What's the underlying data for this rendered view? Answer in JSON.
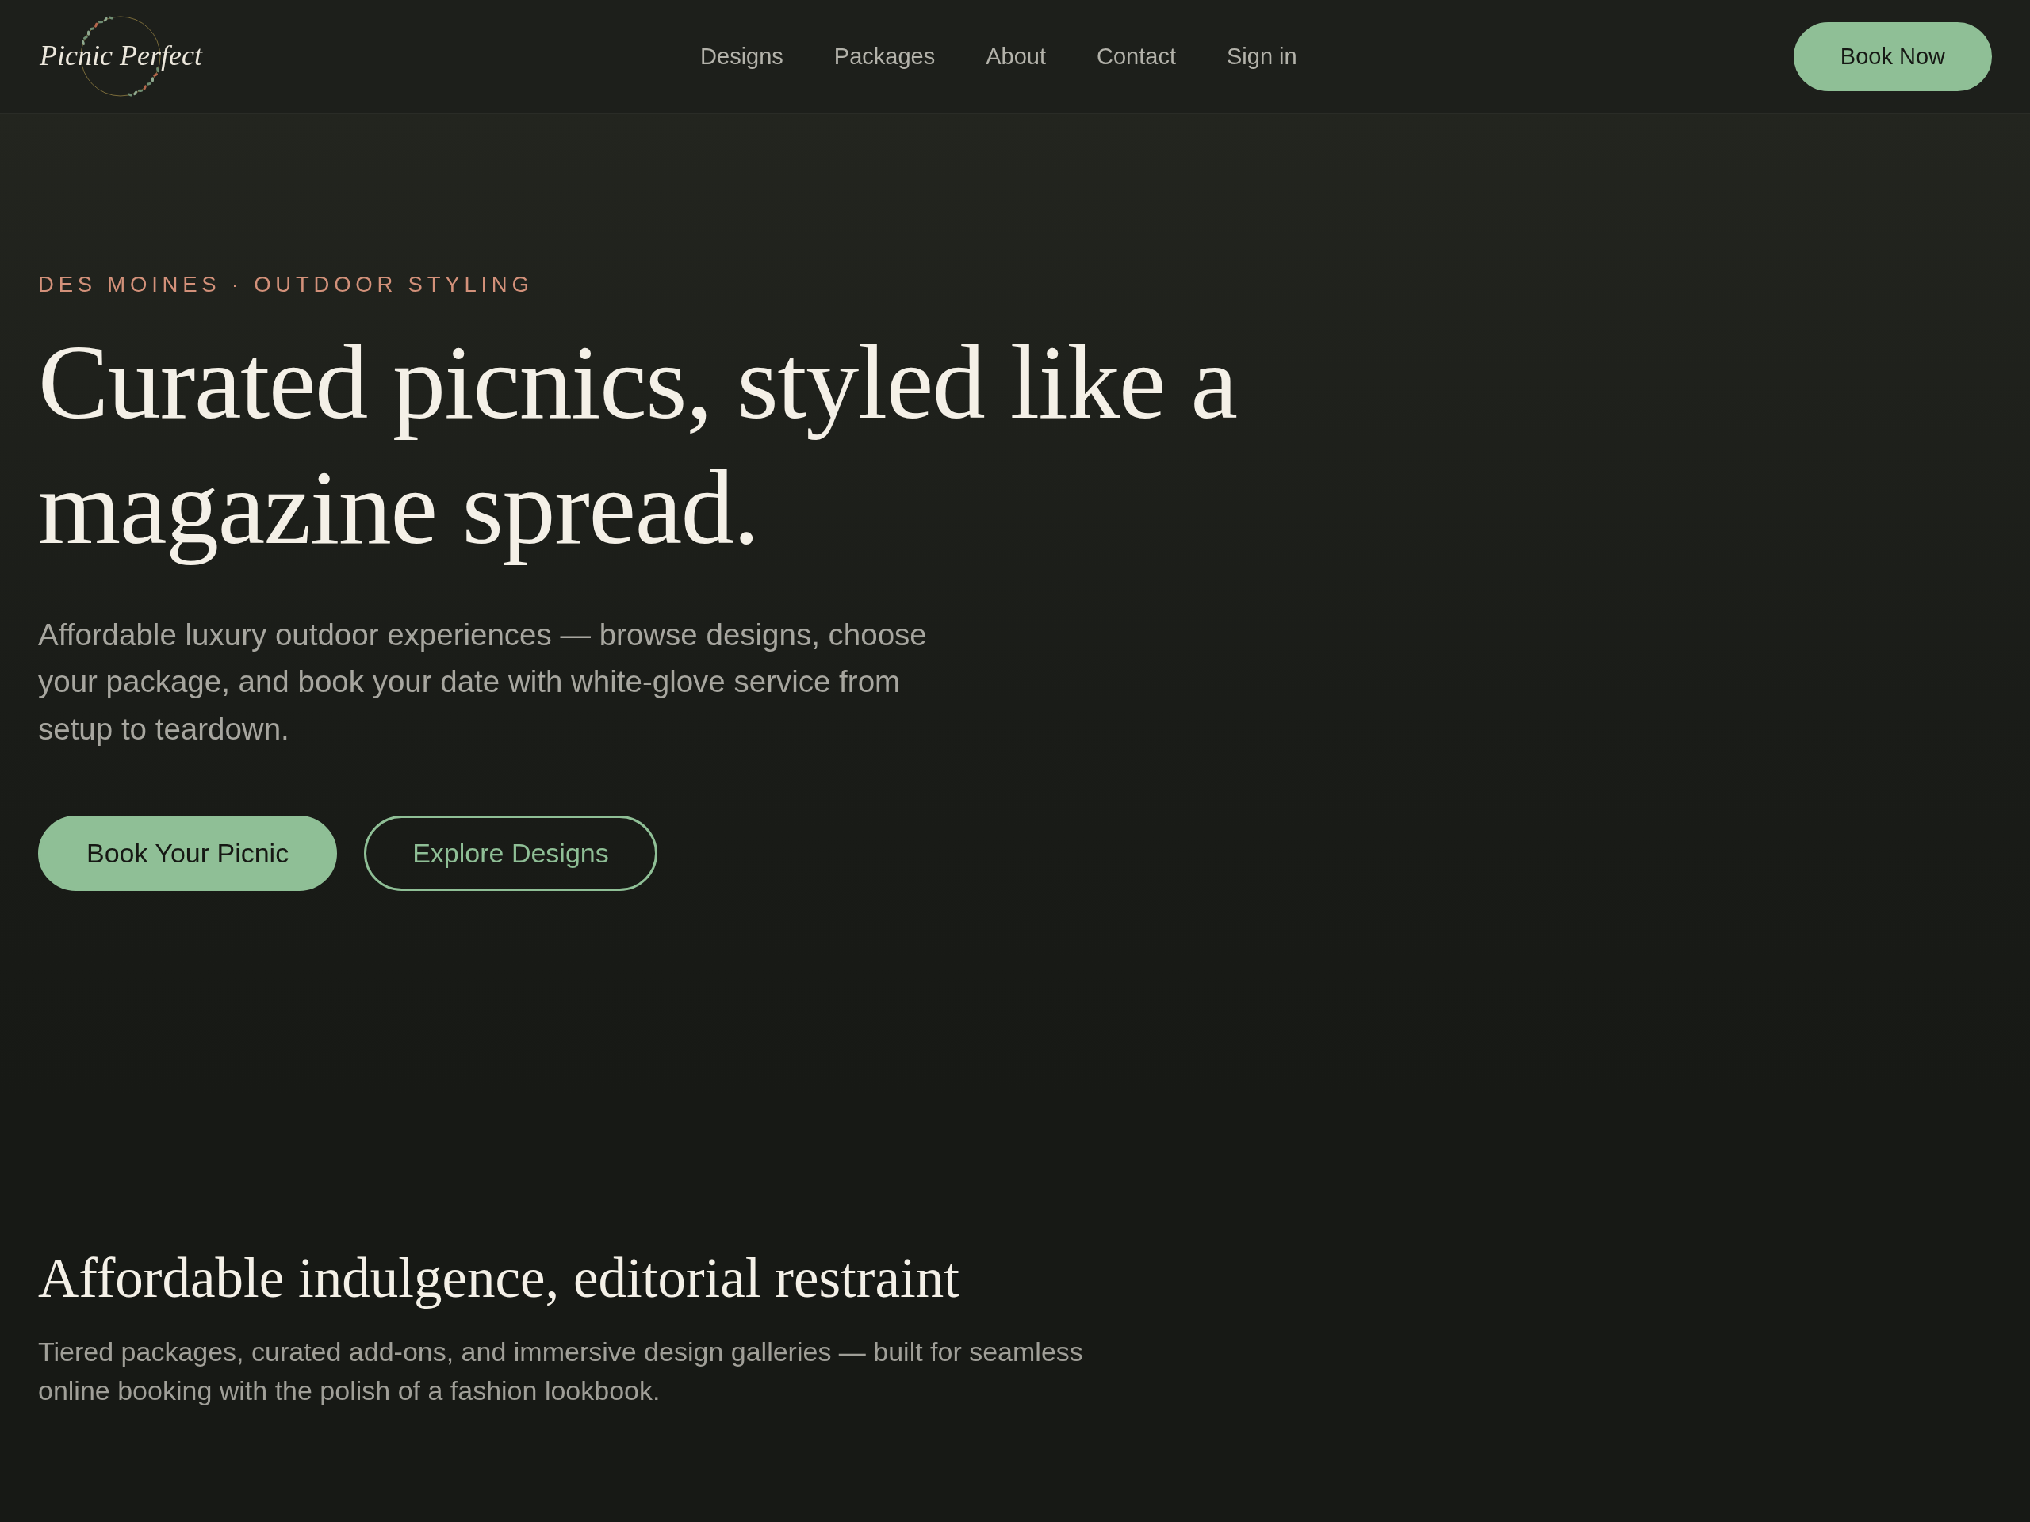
{
  "header": {
    "logo": "Picnic Perfect",
    "nav": [
      "Designs",
      "Packages",
      "About",
      "Contact",
      "Sign in"
    ],
    "cta": "Book Now"
  },
  "hero": {
    "eyebrow": "DES MOINES · OUTDOOR STYLING",
    "headline_lines": [
      "Curated picnics, styled like a",
      "magazine spread."
    ],
    "lede": "Affordable luxury outdoor experiences — browse designs, choose your package, and book your date with white-glove service from setup to teardown.",
    "actions": [
      {
        "label": "Book Your Picnic",
        "kind": "primary"
      },
      {
        "label": "Explore Designs",
        "kind": "outline"
      }
    ]
  },
  "intro": {
    "heading": "Affordable indulgence, editorial restraint",
    "text": "Tiered packages, curated add-ons, and immersive design galleries — built for seamless online booking with the polish of a fashion lookbook."
  }
}
